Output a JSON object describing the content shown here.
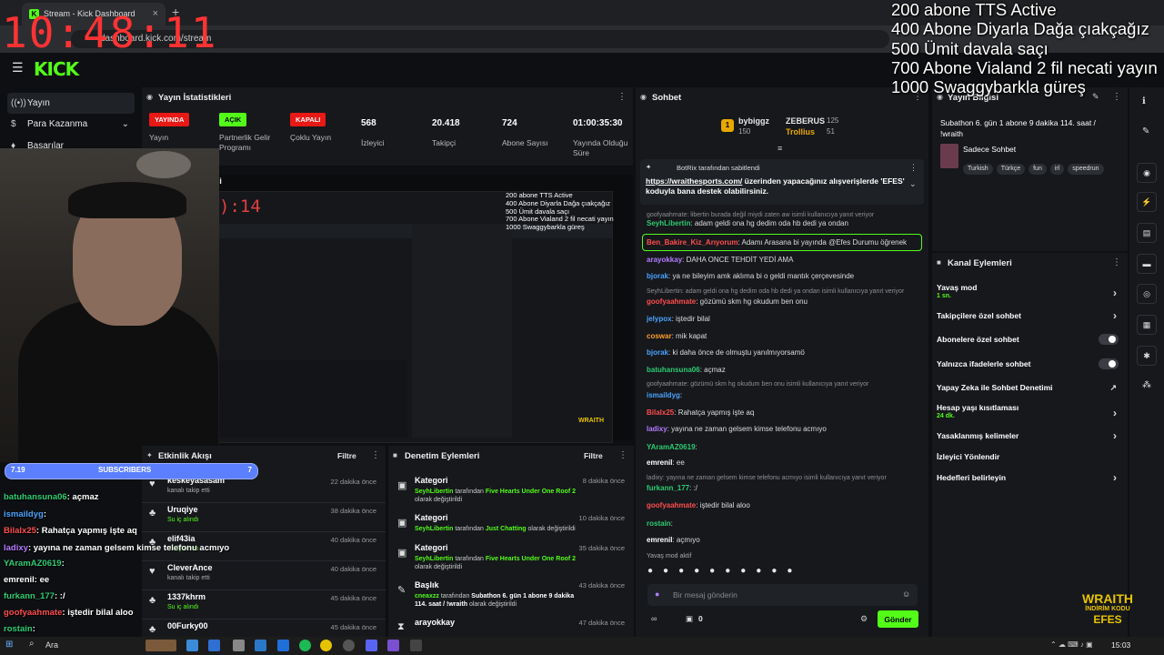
{
  "browser": {
    "tab_title": "Stream - Kick Dashboard",
    "url": "dashboard.kick.com/stream",
    "new_tab": "+"
  },
  "clock": "10:48:11",
  "goals": [
    "200 abone TTS Active",
    "400 Abone Diyarla Dağa çıakçağız",
    "500 Ümit davala saçı",
    "700 Abone Vialand 2 fil necati yayın",
    "1000 Swaggybarkla güreş"
  ],
  "header": {
    "logo": "KICK"
  },
  "nav": [
    {
      "label": "Yayın",
      "icon": "((•))"
    },
    {
      "label": "Para Kazanma",
      "icon": "$"
    },
    {
      "label": "Başarılar",
      "icon": "♦"
    }
  ],
  "stats": {
    "title": "Yayın İstatistikleri",
    "items": [
      {
        "value": "YAYINDA",
        "label": "Yayın",
        "kind": "red"
      },
      {
        "value": "AÇIK",
        "label": "Partnerlik Gelir Programı",
        "kind": "green"
      },
      {
        "value": "KAPALI",
        "label": "Çoklu Yayın",
        "kind": "red"
      },
      {
        "value": "568",
        "label": "İzleyici",
        "kind": "num"
      },
      {
        "value": "20.418",
        "label": "Takipçi",
        "kind": "num"
      },
      {
        "value": "724",
        "label": "Abone Sayısı",
        "kind": "num"
      },
      {
        "value": "01:00:35:30",
        "label": "Yayında Olduğu Süre",
        "kind": "num"
      }
    ]
  },
  "preview": {
    "title_partial": "si",
    "clock_partial": "):14",
    "goals": [
      "200 abone TTS Active",
      "400 Abone Diyarla Dağa çıakçağız",
      "500 Ümit davala saçı",
      "700 Abone Vialand 2 fil necati yayın",
      "1000 Swaggybarkla güreş"
    ],
    "brand": "WRAITH"
  },
  "subscribers": {
    "left": "7.19",
    "label": "SUBSCRIBERS",
    "right": "7"
  },
  "overlay_chat": [
    {
      "user": "batuhansuna06",
      "text": ": açmaz",
      "color": "#2ecc71"
    },
    {
      "user": "ismaildyg",
      "text": ":",
      "color": "#4aa3ff"
    },
    {
      "user": "Bilalx25",
      "text": ": Rahatça yapmış işte aq",
      "color": "#ff4d4d"
    },
    {
      "user": "ladixy",
      "text": ": yayına ne zaman gelsem kimse telefonu acmıyo",
      "color": "#b57bff"
    },
    {
      "user": "YAramAZ0619",
      "text": ":",
      "color": "#2ecc71"
    },
    {
      "user": "emrenil",
      "text": ": ee",
      "color": "#ffffff"
    },
    {
      "user": "furkann_177",
      "text": ": :/",
      "color": "#2ecc71"
    },
    {
      "user": "goofyaahmate",
      "text": ": iştedir bilal aloo",
      "color": "#ff4d4d"
    },
    {
      "user": "rostain",
      "text": ":",
      "color": "#2ecc71"
    }
  ],
  "activity": {
    "title": "Etkinlik Akışı",
    "filter": "Filtre",
    "rows": [
      {
        "name": "keskeyasasam",
        "sub": "kanalı takip etti",
        "time": "22 dakika önce",
        "icon": "♥"
      },
      {
        "name": "Uruqiye",
        "sub": "Su iç alındı",
        "time": "38 dakika önce",
        "icon": "♣"
      },
      {
        "name": "elif43ia",
        "sub": "Su iç alındı",
        "time": "40 dakika önce",
        "icon": "♣"
      },
      {
        "name": "CleverAnce",
        "sub": "kanalı takip etti",
        "time": "40 dakika önce",
        "icon": "♥"
      },
      {
        "name": "1337khrm",
        "sub": "Su iç alındı",
        "time": "45 dakika önce",
        "icon": "♣"
      },
      {
        "name": "00Furky00",
        "sub": "",
        "time": "45 dakika önce",
        "icon": "♣"
      }
    ]
  },
  "modlog": {
    "title": "Denetim Eylemleri",
    "filter": "Filtre",
    "rows": [
      {
        "title": "Kategori",
        "user": "SeyhLibertin",
        "mid": "tarafından",
        "value": "Five Hearts Under One Roof 2",
        "end": "olarak değiştirildi",
        "time": "8 dakika önce"
      },
      {
        "title": "Kategori",
        "user": "SeyhLibertin",
        "mid": "tarafından",
        "value": "Just Chatting",
        "end": "olarak değiştirildi",
        "time": "10 dakika önce"
      },
      {
        "title": "Kategori",
        "user": "SeyhLibertin",
        "mid": "tarafından",
        "value": "Five Hearts Under One Roof 2",
        "end": "olarak değiştirildi",
        "time": "35 dakika önce"
      },
      {
        "title": "Başlık",
        "user": "cneaxzz",
        "mid": "tarafından",
        "value": "Subathon 6. gün 1 abone 9 dakika 114. saat / !wraith",
        "end": "olarak değiştirildi",
        "time": "43 dakika önce"
      },
      {
        "title": "arayokkay",
        "user": "",
        "mid": "",
        "value": "",
        "end": "",
        "time": "47 dakika önce"
      }
    ]
  },
  "chat": {
    "title": "Sohbet",
    "top": [
      {
        "name": "bybiggz",
        "value": "150"
      },
      {
        "name": "ZEBERUS",
        "value": "125"
      },
      {
        "name": "Trollius",
        "value": "51"
      }
    ],
    "pinned_by": "BotRix tarafından sabitlendi",
    "pinned_link": "https://wraithesports.com/",
    "pinned_text": "üzerinden yapacağınız alışverişlerde 'EFES' koduyla bana destek olabilirsiniz.",
    "lines": [
      {
        "reply": true,
        "text": "goofyaahmate: libertin burada değil miydi zaten aw isimli kullanıcıya yanıt veriyor"
      },
      {
        "user": "SeyhLibertin",
        "color": "#2ecc71",
        "text": ": adam geldi ona hg dedim oda hb dedi ya ondan"
      },
      {
        "user": "Ben_Bakire_Kiz_Arıyorum",
        "color": "#ff4d4d",
        "text": ": Adamı Arasana bi yayında @Efes Durumu öğrenek"
      },
      {
        "user": "arayokkay",
        "color": "#b57bff",
        "text": ": DAHA ONCE TEHDİT YEDİ AMA"
      },
      {
        "user": "bjorak",
        "color": "#4aa3ff",
        "text": ": ya ne bileyim amk aklıma bi o geldi mantık çerçevesinde"
      },
      {
        "reply": true,
        "text": "SeyhLibertin: adam geldi ona hg dedim oda hb dedi ya ondan isimli kullanıcıya yanıt veriyor"
      },
      {
        "user": "goofyaahmate",
        "color": "#ff4d4d",
        "text": ": gözümü skm hg okudum ben onu"
      },
      {
        "user": "jelypox",
        "color": "#4aa3ff",
        "text": ": iştedir bilal"
      },
      {
        "user": "coswar",
        "color": "#ff9f2e",
        "text": ": mik kapat"
      },
      {
        "user": "bjorak",
        "color": "#4aa3ff",
        "text": ": ki daha önce de olmuştu yanılmıyorsamö"
      },
      {
        "user": "batuhansuna06",
        "color": "#2ecc71",
        "text": ": açmaz"
      },
      {
        "reply": true,
        "text": "goofyaahmate: gözümü skm hg okudum ben onu isimli kullanıcıya yanıt veriyor"
      },
      {
        "user": "ismaildyg",
        "color": "#4aa3ff",
        "text": ":"
      },
      {
        "user": "Bilalx25",
        "color": "#ff4d4d",
        "text": ": Rahatça yapmış işte aq"
      },
      {
        "user": "ladixy",
        "color": "#b57bff",
        "text": ": yayına ne zaman gelsem kimse telefonu acmıyo"
      },
      {
        "user": "YAramAZ0619",
        "color": "#2ecc71",
        "text": ":"
      },
      {
        "user": "emrenil",
        "color": "#ffffff",
        "text": ": ee"
      },
      {
        "reply": true,
        "text": "ladixy: yayına ne zaman gelsem kimse telefonu acmıyo isimli kullanıcıya yanıt veriyor"
      },
      {
        "user": "furkann_177",
        "color": "#2ecc71",
        "text": ": :/"
      },
      {
        "user": "goofyaahmate",
        "color": "#ff4d4d",
        "text": ": iştedir bilal aloo"
      },
      {
        "user": "rostain",
        "color": "#2ecc71",
        "text": ":"
      },
      {
        "user": "emrenil",
        "color": "#ffffff",
        "text": ": açmıyo"
      }
    ],
    "slow_mode": "Yavaş mod aktif",
    "input_placeholder": "Bir mesaj gönderin",
    "count": "0",
    "send": "Gönder"
  },
  "stream_info": {
    "title": "Yayın Bilgisi",
    "stream_title": "Subathon 6. gün 1 abone 9 dakika 114. saat / !wraith",
    "category": "Sadece Sohbet",
    "tags": [
      "Turkish",
      "Türkçe",
      "fun",
      "irl",
      "speedrun"
    ]
  },
  "channel_actions": {
    "title": "Kanal Eylemleri",
    "rows": [
      {
        "label": "Yavaş mod",
        "sub": "1 sn.",
        "type": "chev"
      },
      {
        "label": "Takipçilere özel sohbet",
        "sub": "",
        "type": "chev"
      },
      {
        "label": "Abonelere özel sohbet",
        "sub": "",
        "type": "toggle"
      },
      {
        "label": "Yalnızca ifadelerle sohbet",
        "sub": "",
        "type": "toggle"
      },
      {
        "label": "Yapay Zeka ile Sohbet Denetimi",
        "sub": "",
        "type": "ext"
      },
      {
        "label": "Hesap yaşı kısıtlaması",
        "sub": "24 dk.",
        "type": "chev"
      },
      {
        "label": "Yasaklanmış kelimeler",
        "sub": "",
        "type": "chev"
      },
      {
        "label": "İzleyici Yönlendir",
        "sub": "",
        "type": "none"
      },
      {
        "label": "Hedefleri belirleyin",
        "sub": "",
        "type": "chev"
      }
    ]
  },
  "taskbar": {
    "search": "Ara",
    "time": "15:03"
  },
  "brand_overlay": {
    "line1": "WRAITH",
    "line2": "İNDİRİM KODU",
    "line3": "EFES"
  },
  "colors": {
    "accent": "#53fc18",
    "live_red": "#e91916",
    "panel": "#16181c",
    "clock": "#ff3333"
  }
}
